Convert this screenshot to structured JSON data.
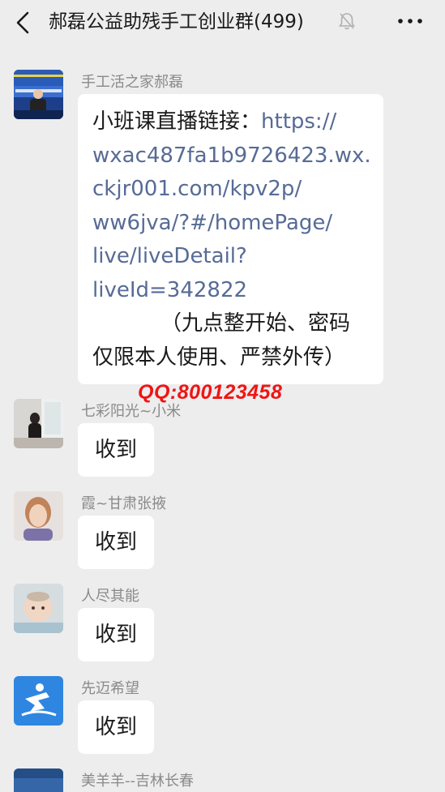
{
  "header": {
    "title": "郝磊公益助残手工创业群(499)",
    "back_icon": "chevron-left-icon",
    "mute_icon": "bell-muted-icon",
    "more_icon": "more-horizontal-icon"
  },
  "messages": [
    {
      "sender": "手工活之家郝磊",
      "avatar": "avatar-photo-speaker",
      "lines": [
        {
          "plain": "小班课直播链接：",
          "link": "https://"
        },
        {
          "plain": "",
          "link": "wxac487fa1b9726423.wx."
        },
        {
          "plain": "",
          "link": "ckjr001.com/kpv2p/"
        },
        {
          "plain": "",
          "link": "ww6jva/?#/homePage/"
        },
        {
          "plain": "",
          "link": "live/liveDetail?"
        },
        {
          "plain": "",
          "link": "liveId=342822"
        },
        {
          "plain": "（九点整开始、密码",
          "link": ""
        },
        {
          "plain": "仅限本人使用、严禁外传）",
          "link": ""
        }
      ]
    },
    {
      "sender": "七彩阳光~小米",
      "text": "收到",
      "avatar": "avatar-photo-woman-window"
    },
    {
      "sender": "霞~甘肃张掖",
      "text": "收到",
      "avatar": "avatar-photo-woman-portrait"
    },
    {
      "sender": "人尽其能",
      "text": "收到",
      "avatar": "avatar-photo-baby"
    },
    {
      "sender": "先迈希望",
      "text": "收到",
      "avatar": "avatar-logo-blue-runner"
    },
    {
      "sender": "美羊羊--吉林长春",
      "text": "",
      "avatar": "avatar-photo-blue"
    }
  ],
  "watermark": "QQ:800123458",
  "colors": {
    "background": "#ededed",
    "bubble": "#ffffff",
    "link": "#576b95",
    "sender": "#8a8a8a",
    "watermark": "#f01414"
  }
}
